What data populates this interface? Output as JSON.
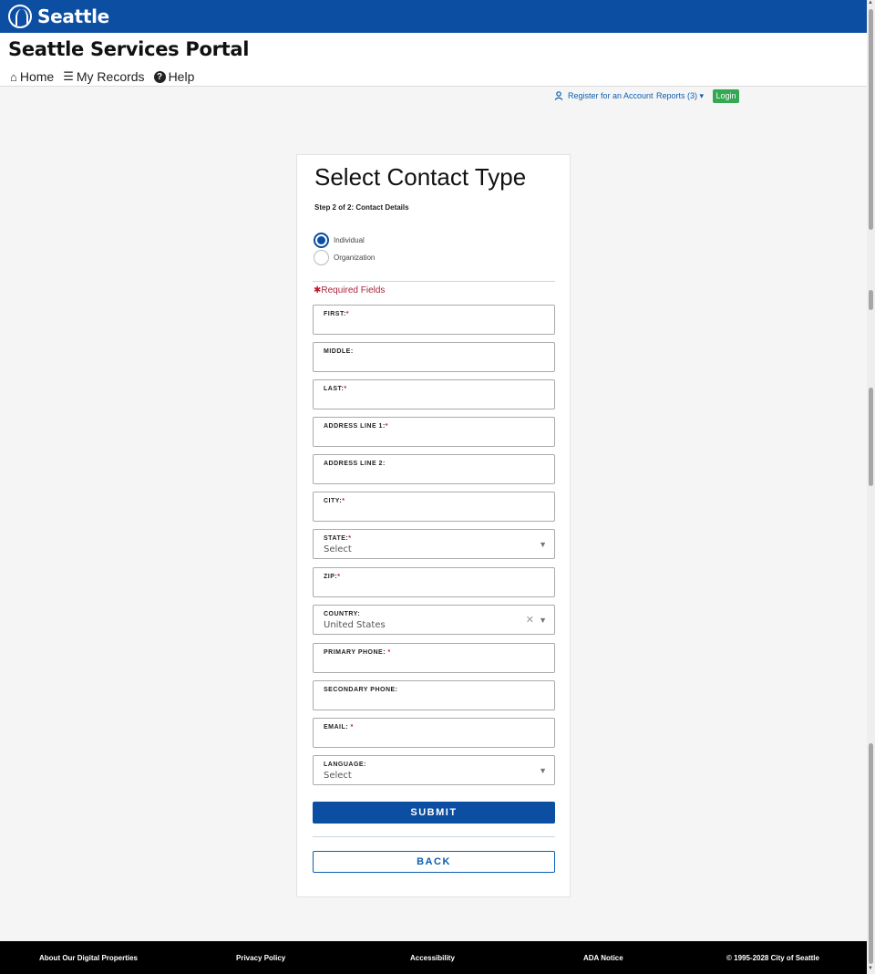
{
  "brand": {
    "name": "Seattle"
  },
  "header": {
    "title": "Seattle Services Portal",
    "nav": [
      {
        "label": "Home",
        "icon": "home-icon"
      },
      {
        "label": "My Records",
        "icon": "list-icon"
      },
      {
        "label": "Help",
        "icon": "help-icon"
      }
    ]
  },
  "utility": {
    "register": "Register for an Account",
    "reports": "Reports (3)",
    "login": "Login"
  },
  "form": {
    "title": "Select Contact Type",
    "step": "Step 2 of 2: Contact Details",
    "contact_types": [
      {
        "label": "Individual",
        "selected": true
      },
      {
        "label": "Organization",
        "selected": false
      }
    ],
    "required_note": "Required Fields",
    "fields": [
      {
        "label": "FIRST:",
        "required": true,
        "value": ""
      },
      {
        "label": "MIDDLE:",
        "required": false,
        "value": ""
      },
      {
        "label": "LAST:",
        "required": true,
        "value": ""
      },
      {
        "label": "ADDRESS LINE 1:",
        "required": true,
        "value": ""
      },
      {
        "label": "ADDRESS LINE 2:",
        "required": false,
        "value": ""
      },
      {
        "label": "CITY:",
        "required": true,
        "value": ""
      },
      {
        "label": "STATE:",
        "required": true,
        "value": "Select"
      },
      {
        "label": "ZIP:",
        "required": true,
        "value": ""
      },
      {
        "label": "COUNTRY:",
        "required": false,
        "value": "United States"
      },
      {
        "label": "PRIMARY PHONE:",
        "required": true,
        "value": ""
      },
      {
        "label": "SECONDARY PHONE:",
        "required": false,
        "value": ""
      },
      {
        "label": "EMAIL:",
        "required": true,
        "value": ""
      },
      {
        "label": "LANGUAGE:",
        "required": false,
        "value": "Select"
      }
    ],
    "submit_label": "SUBMIT",
    "back_label": "BACK"
  },
  "footer": {
    "links": [
      "About Our Digital Properties",
      "Privacy Policy",
      "Accessibility",
      "ADA Notice",
      "© 1995-2028 City of Seattle"
    ]
  },
  "colors": {
    "brand_blue": "#0b4ea2",
    "link_blue": "#0b5fb0",
    "login_green": "#34a853",
    "required_red": "#c0162b"
  }
}
